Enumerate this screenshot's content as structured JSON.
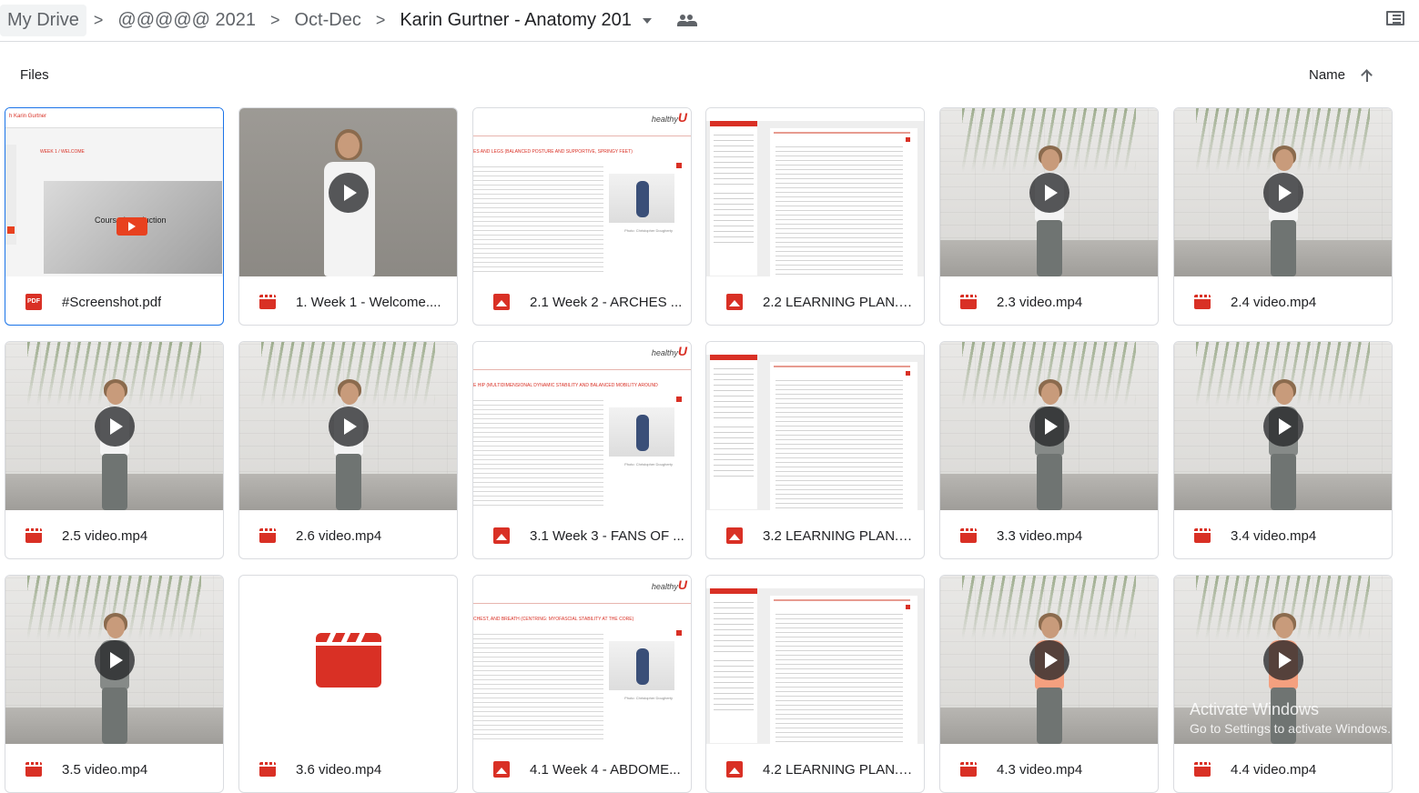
{
  "breadcrumb": {
    "items": [
      "My Drive",
      "@@@@@ 2021",
      "Oct-Dec",
      "Karin Gurtner - Anatomy 201"
    ],
    "separator": ">"
  },
  "section": {
    "label": "Files",
    "sort_label": "Name"
  },
  "files": [
    {
      "name": "#Screenshot.pdf",
      "type": "pdf",
      "thumb": "screenshot",
      "thumb_text": "Course Introduction",
      "header_text": "h Karin Gurtner",
      "week_text": "WEEK 1 / WELCOME",
      "selected": true
    },
    {
      "name": "1. Week 1 - Welcome....",
      "type": "video",
      "thumb": "intro"
    },
    {
      "name": "2.1 Week 2 - ARCHES ...",
      "type": "image",
      "thumb": "doc",
      "doc_title": "ES AND LEGS (BALANCED POSTURE AND SUPPORTIVE, SPRINGY FEET)",
      "caption": "Photo: Christopher Dougherty"
    },
    {
      "name": "2.2 LEARNING PLAN.p...",
      "type": "image",
      "thumb": "plan"
    },
    {
      "name": "2.3 video.mp4",
      "type": "video",
      "thumb": "person"
    },
    {
      "name": "2.4 video.mp4",
      "type": "video",
      "thumb": "person"
    },
    {
      "name": "2.5 video.mp4",
      "type": "video",
      "thumb": "person"
    },
    {
      "name": "2.6 video.mp4",
      "type": "video",
      "thumb": "person"
    },
    {
      "name": "3.1 Week 3 - FANS OF ...",
      "type": "image",
      "thumb": "doc",
      "doc_title": "E HIP (MULTIDIMENSIONAL DYNAMIC STABILITY AND BALANCED MOBILITY AROUND",
      "caption": "Photo: Christopher Dougherty"
    },
    {
      "name": "3.2 LEARNING PLAN.p...",
      "type": "image",
      "thumb": "plan"
    },
    {
      "name": "3.3 video.mp4",
      "type": "video",
      "thumb": "person-dark"
    },
    {
      "name": "3.4 video.mp4",
      "type": "video",
      "thumb": "person-dark"
    },
    {
      "name": "3.5 video.mp4",
      "type": "video",
      "thumb": "person-dark"
    },
    {
      "name": "3.6 video.mp4",
      "type": "video",
      "thumb": "clapper"
    },
    {
      "name": "4.1 Week 4 - ABDOME...",
      "type": "image",
      "thumb": "doc",
      "doc_title": "CHEST, AND BREATH (CENTRING: MYOFASCIAL STABILITY AT THE CORE)",
      "caption": "Photo: Christopher Dougherty"
    },
    {
      "name": "4.2 LEARNING PLAN.p...",
      "type": "image",
      "thumb": "plan"
    },
    {
      "name": "4.3 video.mp4",
      "type": "video",
      "thumb": "person-orange"
    },
    {
      "name": "4.4 video.mp4",
      "type": "video",
      "thumb": "person-orange"
    }
  ],
  "type_labels": {
    "pdf": "PDF"
  },
  "watermark": {
    "line1": "Activate Windows",
    "line2": "Go to Settings to activate Windows."
  },
  "colors": {
    "accent": "#d93025",
    "selection": "#1a73e8"
  }
}
